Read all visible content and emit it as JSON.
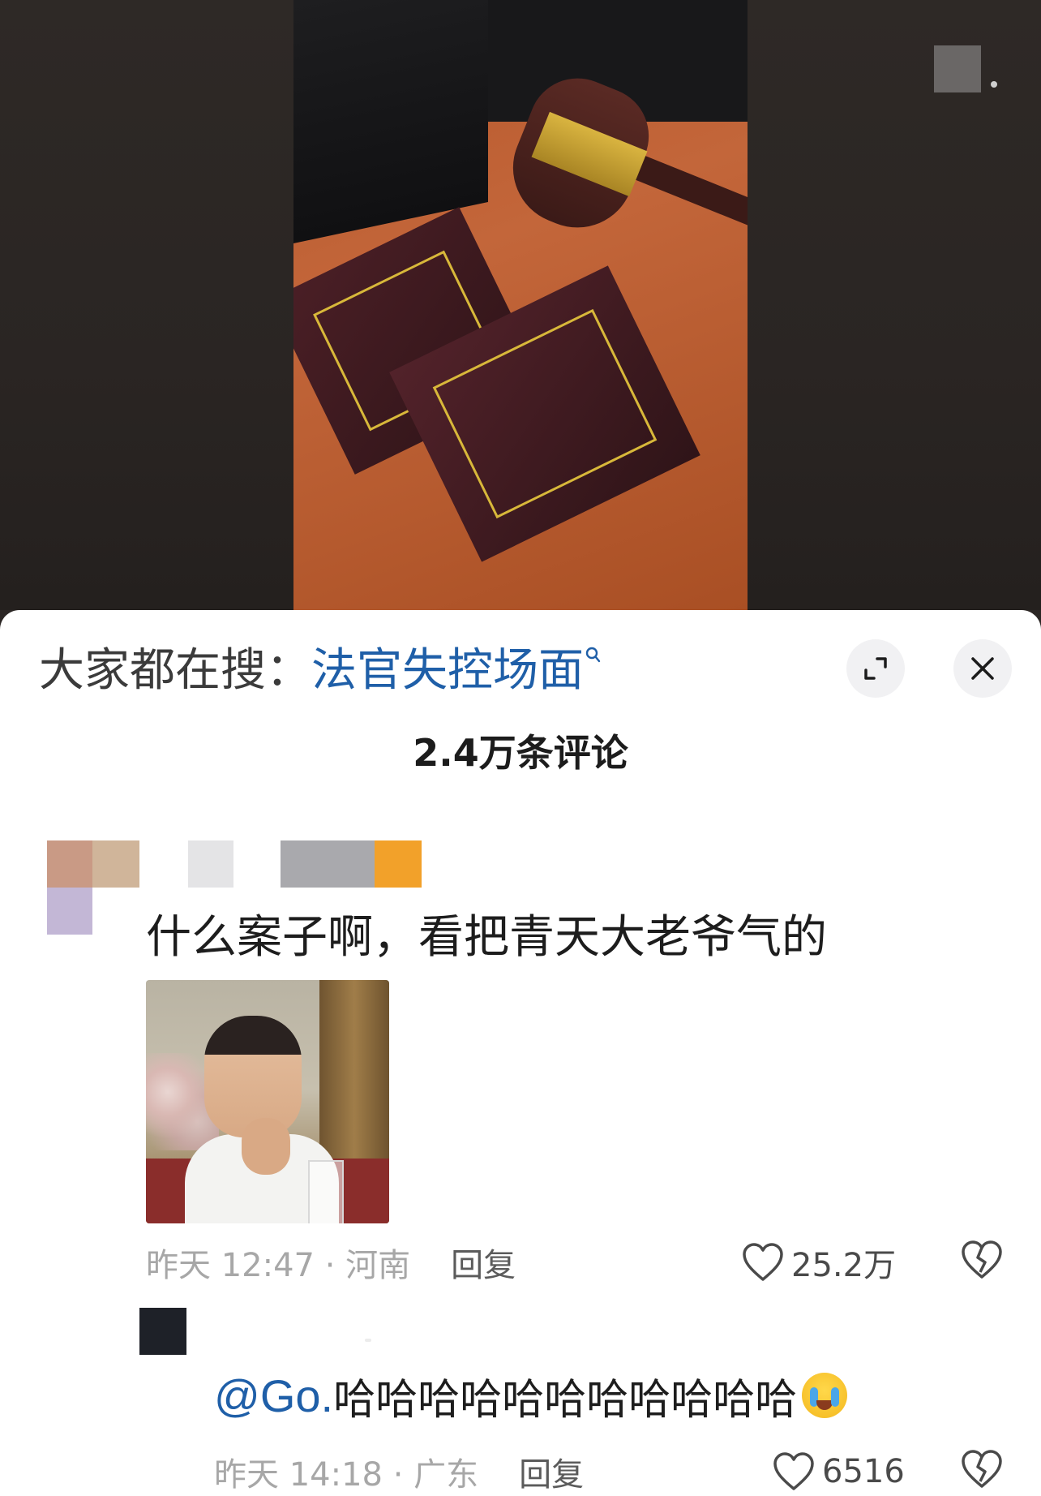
{
  "video": {
    "description_icons": [
      "expand-icon",
      "close-icon"
    ]
  },
  "header": {
    "search_prefix": "大家都在搜：",
    "search_term": "法官失控场面",
    "search_icon": "search-icon",
    "comment_count": "2.4万条评论"
  },
  "comments": [
    {
      "text": "什么案子啊，看把青天大老爷气的",
      "time_location": "昨天 12:47 · 河南",
      "reply_label": "回复",
      "likes": "25.2万"
    },
    {
      "mention": "@Go.",
      "text": " 哈哈哈哈哈哈哈哈哈哈哈",
      "emoji": "crying-laughing-emoji",
      "time_location": "昨天 14:18 · 广东",
      "reply_label": "回复",
      "likes": "6516"
    }
  ],
  "colors": {
    "link_blue": "#1f5fa8",
    "meta_gray": "#a7a7a7",
    "sheet_bg": "#ffffff",
    "backdrop": "#2b2624"
  }
}
